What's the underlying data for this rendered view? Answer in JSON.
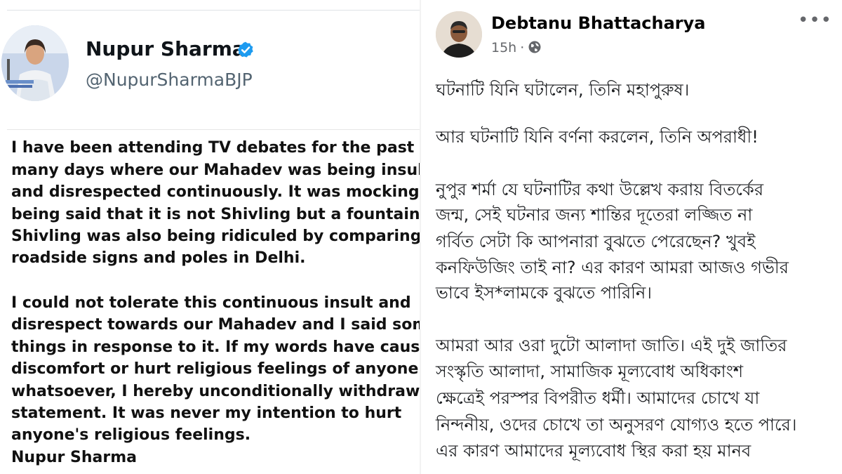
{
  "twitter": {
    "name": "Nupur Sharma",
    "handle": "@NupurSharmaBJP",
    "verified_color": "#1d9bf0",
    "body_lines": [
      "I have been attending TV debates for the past",
      "many days where our Mahadev was being insulte",
      "and disrespected continuously. It was mockingly",
      "being said that it is not Shivling but a fountain. T",
      "Shivling was also being ridiculed by comparing it",
      "roadside signs and poles in Delhi.",
      "I could not tolerate this continuous insult and",
      "disrespect towards our Mahadev and I said some",
      "things in response to it. If my words have caused",
      "discomfort or hurt religious feelings of anyone",
      "whatsoever, I hereby unconditionally withdraw m",
      "statement. It was never my intention to hurt",
      "anyone's religious feelings.",
      "Nupur Sharma"
    ]
  },
  "facebook": {
    "name": "Debtanu Bhattacharya",
    "time": "15h",
    "dot": "·",
    "more": "•••",
    "body_lines": [
      "ঘটনাটি যিনি ঘটালেন, তিনি মহাপুরুষ।",
      "আর ঘটনাটি যিনি বর্ণনা করলেন, তিনি অপরাধী!",
      "নুপুর শর্মা যে ঘটনাটির কথা উল্লেখ করায় বিতর্কের",
      "জন্ম, সেই ঘটনার জন্য শান্তির দূতেরা লজ্জিত না",
      "গর্বিত সেটা কি আপনারা বুঝতে পেরেছেন? খুবই",
      "কনফিউজিং তাই না? এর কারণ আমরা আজও গভীর",
      "ভাবে ইস*লামকে বুঝতে পারিনি।",
      "আমরা আর ওরা দুটো আলাদা জাতি। এই দুই জাতির",
      "সংস্কৃতি আলাদা, সামাজিক মূল্যবোধ অধিকাংশ",
      "ক্ষেত্রেই পরস্পর বিপরীত ধর্মী। আমাদের চোখে যা",
      "নিন্দনীয়, ওদের চোখে তা অনুসরণ যোগ্যও হতে পারে।",
      "এর কারণ আমাদের মূল্যবোধ স্থির করা হয় মানব"
    ]
  }
}
